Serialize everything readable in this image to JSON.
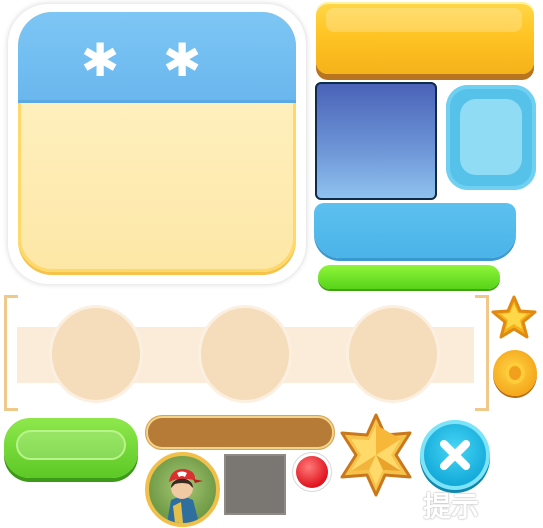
{
  "panel": {
    "header_color": "#7dc6f5",
    "body_color": "#fff1c0",
    "decorations": [
      "snowflake-icon",
      "snowflake-icon"
    ],
    "snowflake_glyph": "✱"
  },
  "buttons": {
    "yellow_color": "#ffc424",
    "green_color": "#5cc826",
    "close_glyph": "✕",
    "close_color": "#13a9d9"
  },
  "tiles": {
    "blue_square_color": "#6f98d8",
    "cyan_square_color": "#57c2e9",
    "blue_tab_color": "#4bb3e8",
    "grey_square_color": "#7a7672"
  },
  "progress": {
    "green_fill_fraction": 1.0,
    "green_color": "#56d419"
  },
  "slots": {
    "count": 3,
    "slot_color": "#f5dcbb"
  },
  "brown_bar": {
    "color": "#b67b36"
  },
  "icons": {
    "star_badge": "star-icon",
    "coin": "coin-icon",
    "gold_star": "star-icon",
    "red_dot": "notification-dot-icon",
    "avatar": "avatar"
  },
  "hint": {
    "label": "提示"
  }
}
